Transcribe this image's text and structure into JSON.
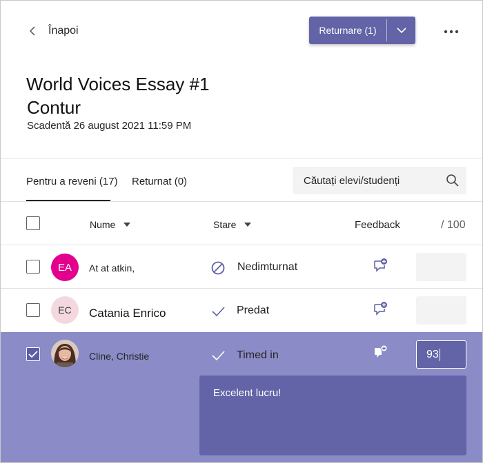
{
  "header": {
    "back_label": "Înapoi",
    "return_button_label": "Returnare (1)"
  },
  "assignment": {
    "title_line1": "World Voices Essay #1",
    "title_line2": "Contur",
    "due": "Scadentă 26 august 2021 11:59 PM"
  },
  "tabs": [
    {
      "label": "Pentru a reveni (17)",
      "active": true
    },
    {
      "label": "Returnat (0)",
      "active": false
    }
  ],
  "search": {
    "placeholder": "Căutați elevi/studenți"
  },
  "columns": {
    "name": "Nume",
    "status": "Stare",
    "feedback": "Feedback",
    "points": "/ 100"
  },
  "students": [
    {
      "initials": "EA",
      "name": "At at atkin,",
      "status": "Nedimturnat",
      "status_icon": "not-submitted-icon",
      "grade": "",
      "selected": false,
      "avatar_color": "#e3008c"
    },
    {
      "initials": "EC",
      "name": "Catania Enrico",
      "status": "Predat",
      "status_icon": "check-icon",
      "grade": "",
      "selected": false,
      "avatar_color": "#f4d8df"
    },
    {
      "initials": "",
      "name": "Cline, Christie",
      "status": "Timed in",
      "status_icon": "check-icon",
      "grade": "93",
      "selected": true,
      "feedback": "Excelent lucru!"
    }
  ],
  "colors": {
    "accent": "#6264a7",
    "selected_row": "#8b8cc7"
  }
}
